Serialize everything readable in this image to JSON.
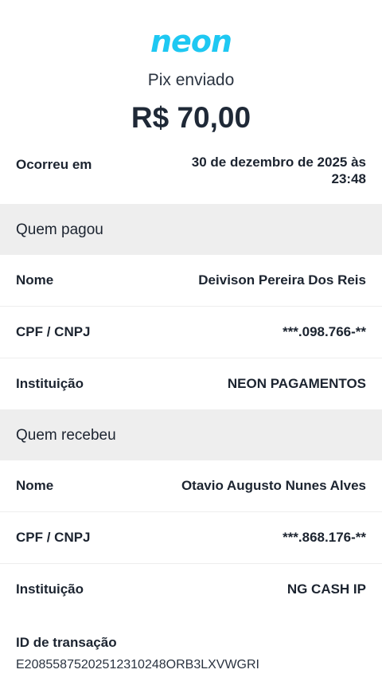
{
  "brand": {
    "logo_text": "neon",
    "accent_color": "#1ec8f2"
  },
  "receipt": {
    "subtitle": "Pix enviado",
    "amount": "R$ 70,00",
    "occurred": {
      "label": "Ocorreu em",
      "value_line1": "30 de dezembro de 2025 às",
      "value_line2": "23:48"
    }
  },
  "payer": {
    "title": "Quem pagou",
    "name_label": "Nome",
    "name_value": "Deivison Pereira Dos Reis",
    "doc_label": "CPF / CNPJ",
    "doc_value": "***.098.766-**",
    "institution_label": "Instituição",
    "institution_value": "NEON PAGAMENTOS"
  },
  "payee": {
    "title": "Quem recebeu",
    "name_label": "Nome",
    "name_value": "Otavio Augusto Nunes Alves",
    "doc_label": "CPF / CNPJ",
    "doc_value": "***.868.176-**",
    "institution_label": "Instituição",
    "institution_value": "NG CASH IP"
  },
  "transaction": {
    "id_label": "ID de transação",
    "id_value": "E20855875202512310248ORB3LXVWGRI"
  },
  "colors": {
    "section_background": "#eeeeee",
    "text": "#1c2430"
  }
}
